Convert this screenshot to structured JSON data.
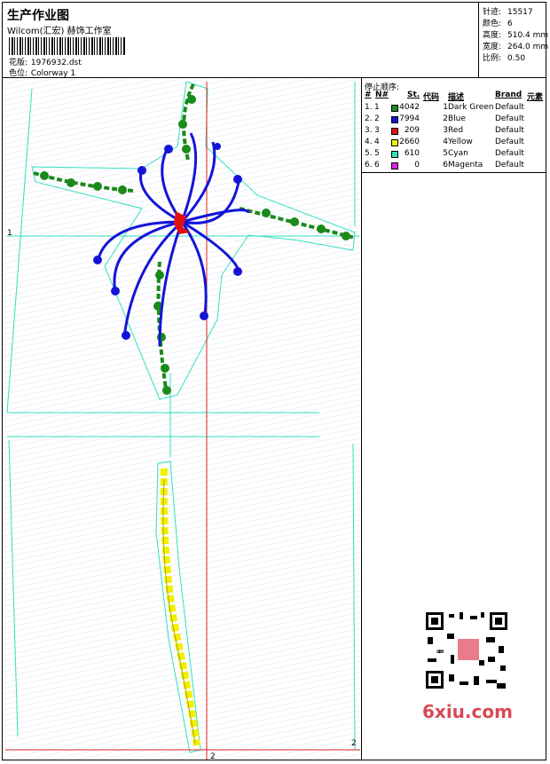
{
  "header": {
    "title": "生产作业图",
    "company": "Wilcom(汇宏) 赫饰工作室",
    "design_label": "花版:",
    "design_value": "1976932.dst",
    "colorway_label": "色位:",
    "colorway_value": "Colorway 1"
  },
  "stats": {
    "stitches_label": "针迹:",
    "stitches_value": "15517",
    "colors_label": "颜色:",
    "colors_value": "6",
    "height_label": "高度:",
    "height_value": "510.4 mm",
    "width_label": "宽度:",
    "width_value": "264.0 mm",
    "scale_label": "比例:",
    "scale_value": "0.50"
  },
  "stop_sequence": {
    "title": "停止顺序:",
    "headers": {
      "hash": "#",
      "no": "N#",
      "st": "St.",
      "code": "代码",
      "desc": "描述",
      "brand": "Brand",
      "element": "元素"
    },
    "rows": [
      {
        "num": "1.",
        "no": "1",
        "color": "#1a8a1a",
        "st": "4042",
        "code": "1",
        "desc": "Dark Green",
        "brand": "Default"
      },
      {
        "num": "2.",
        "no": "2",
        "color": "#1414d8",
        "st": "7994",
        "code": "2",
        "desc": "Blue",
        "brand": "Default"
      },
      {
        "num": "3.",
        "no": "3",
        "color": "#e01010",
        "st": "209",
        "code": "3",
        "desc": "Red",
        "brand": "Default"
      },
      {
        "num": "4.",
        "no": "4",
        "color": "#f0f000",
        "st": "2660",
        "code": "4",
        "desc": "Yellow",
        "brand": "Default"
      },
      {
        "num": "5.",
        "no": "5",
        "color": "#30e0c0",
        "st": "610",
        "code": "5",
        "desc": "Cyan",
        "brand": "Default"
      },
      {
        "num": "6.",
        "no": "6",
        "color": "#e020e0",
        "st": "0",
        "code": "6",
        "desc": "Magenta",
        "brand": "Default"
      }
    ]
  },
  "axis_marks": {
    "left": "1",
    "right": "2",
    "bottom": "2"
  },
  "watermark": "6xiu.com",
  "qr_stamp": "刺绣图",
  "colors": {
    "green": "#1a8a1a",
    "blue": "#1414d8",
    "red": "#e01010",
    "yellow": "#f0f000",
    "cyan": "#30e0c0",
    "guide": "#e02020"
  }
}
